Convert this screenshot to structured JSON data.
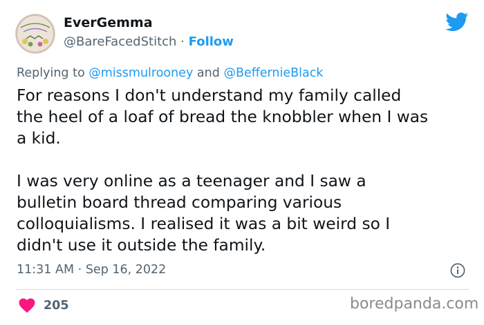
{
  "author": {
    "name": "EverGemma",
    "handle": "@BareFacedStitch",
    "separator": "·",
    "follow_label": "Follow",
    "avatar_icon": "embroidery-hoop-avatar"
  },
  "platform_icon": "twitter-bird-icon",
  "reply": {
    "prefix": "Replying to",
    "mention1": "@missmulrooney",
    "joiner": "and",
    "mention2": "@BeffernieBlack"
  },
  "tweet": {
    "lines": [
      "For reasons I don't understand my family called",
      "the heel of a loaf of bread the knobbler when I was",
      "a kid.",
      "",
      "I was very online as a teenager and I saw a",
      "bulletin board thread comparing various",
      "colloquialisms. I realised it was a bit weird so I",
      "didn't use it outside the family."
    ]
  },
  "meta": {
    "time": "11:31 AM",
    "separator": "·",
    "date": "Sep 16, 2022",
    "info_icon": "info-icon"
  },
  "engagement": {
    "likes": "205",
    "heart_icon": "heart-icon"
  },
  "watermark": "boredpanda.com",
  "colors": {
    "accent": "#1d9bf0",
    "heart": "#f91880",
    "secondary_text": "#536471",
    "primary_text": "#0f1419"
  }
}
